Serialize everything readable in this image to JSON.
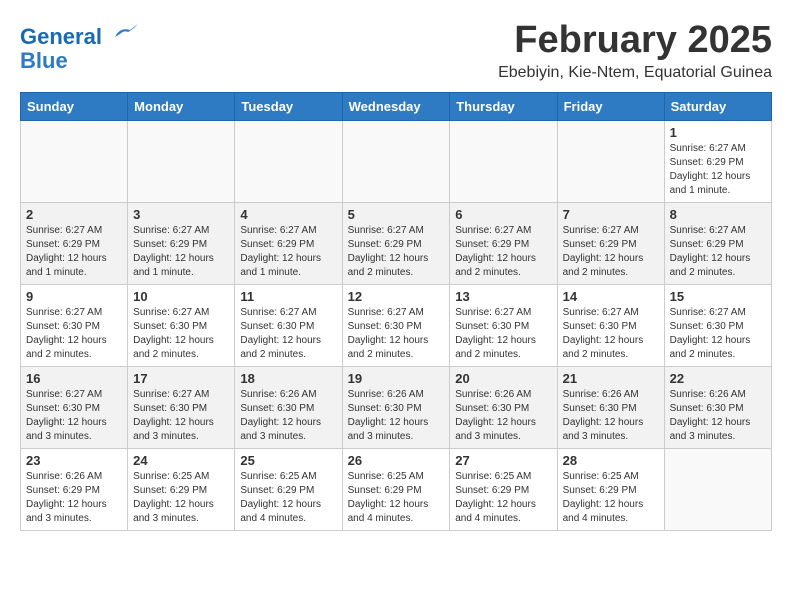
{
  "header": {
    "logo_line1": "General",
    "logo_line2": "Blue",
    "month": "February 2025",
    "location": "Ebebiyin, Kie-Ntem, Equatorial Guinea"
  },
  "days_of_week": [
    "Sunday",
    "Monday",
    "Tuesday",
    "Wednesday",
    "Thursday",
    "Friday",
    "Saturday"
  ],
  "weeks": [
    {
      "days": [
        {
          "number": "",
          "info": ""
        },
        {
          "number": "",
          "info": ""
        },
        {
          "number": "",
          "info": ""
        },
        {
          "number": "",
          "info": ""
        },
        {
          "number": "",
          "info": ""
        },
        {
          "number": "",
          "info": ""
        },
        {
          "number": "1",
          "info": "Sunrise: 6:27 AM\nSunset: 6:29 PM\nDaylight: 12 hours and 1 minute."
        }
      ]
    },
    {
      "days": [
        {
          "number": "2",
          "info": "Sunrise: 6:27 AM\nSunset: 6:29 PM\nDaylight: 12 hours and 1 minute."
        },
        {
          "number": "3",
          "info": "Sunrise: 6:27 AM\nSunset: 6:29 PM\nDaylight: 12 hours and 1 minute."
        },
        {
          "number": "4",
          "info": "Sunrise: 6:27 AM\nSunset: 6:29 PM\nDaylight: 12 hours and 1 minute."
        },
        {
          "number": "5",
          "info": "Sunrise: 6:27 AM\nSunset: 6:29 PM\nDaylight: 12 hours and 2 minutes."
        },
        {
          "number": "6",
          "info": "Sunrise: 6:27 AM\nSunset: 6:29 PM\nDaylight: 12 hours and 2 minutes."
        },
        {
          "number": "7",
          "info": "Sunrise: 6:27 AM\nSunset: 6:29 PM\nDaylight: 12 hours and 2 minutes."
        },
        {
          "number": "8",
          "info": "Sunrise: 6:27 AM\nSunset: 6:29 PM\nDaylight: 12 hours and 2 minutes."
        }
      ]
    },
    {
      "days": [
        {
          "number": "9",
          "info": "Sunrise: 6:27 AM\nSunset: 6:30 PM\nDaylight: 12 hours and 2 minutes."
        },
        {
          "number": "10",
          "info": "Sunrise: 6:27 AM\nSunset: 6:30 PM\nDaylight: 12 hours and 2 minutes."
        },
        {
          "number": "11",
          "info": "Sunrise: 6:27 AM\nSunset: 6:30 PM\nDaylight: 12 hours and 2 minutes."
        },
        {
          "number": "12",
          "info": "Sunrise: 6:27 AM\nSunset: 6:30 PM\nDaylight: 12 hours and 2 minutes."
        },
        {
          "number": "13",
          "info": "Sunrise: 6:27 AM\nSunset: 6:30 PM\nDaylight: 12 hours and 2 minutes."
        },
        {
          "number": "14",
          "info": "Sunrise: 6:27 AM\nSunset: 6:30 PM\nDaylight: 12 hours and 2 minutes."
        },
        {
          "number": "15",
          "info": "Sunrise: 6:27 AM\nSunset: 6:30 PM\nDaylight: 12 hours and 2 minutes."
        }
      ]
    },
    {
      "days": [
        {
          "number": "16",
          "info": "Sunrise: 6:27 AM\nSunset: 6:30 PM\nDaylight: 12 hours and 3 minutes."
        },
        {
          "number": "17",
          "info": "Sunrise: 6:27 AM\nSunset: 6:30 PM\nDaylight: 12 hours and 3 minutes."
        },
        {
          "number": "18",
          "info": "Sunrise: 6:26 AM\nSunset: 6:30 PM\nDaylight: 12 hours and 3 minutes."
        },
        {
          "number": "19",
          "info": "Sunrise: 6:26 AM\nSunset: 6:30 PM\nDaylight: 12 hours and 3 minutes."
        },
        {
          "number": "20",
          "info": "Sunrise: 6:26 AM\nSunset: 6:30 PM\nDaylight: 12 hours and 3 minutes."
        },
        {
          "number": "21",
          "info": "Sunrise: 6:26 AM\nSunset: 6:30 PM\nDaylight: 12 hours and 3 minutes."
        },
        {
          "number": "22",
          "info": "Sunrise: 6:26 AM\nSunset: 6:30 PM\nDaylight: 12 hours and 3 minutes."
        }
      ]
    },
    {
      "days": [
        {
          "number": "23",
          "info": "Sunrise: 6:26 AM\nSunset: 6:29 PM\nDaylight: 12 hours and 3 minutes."
        },
        {
          "number": "24",
          "info": "Sunrise: 6:25 AM\nSunset: 6:29 PM\nDaylight: 12 hours and 3 minutes."
        },
        {
          "number": "25",
          "info": "Sunrise: 6:25 AM\nSunset: 6:29 PM\nDaylight: 12 hours and 4 minutes."
        },
        {
          "number": "26",
          "info": "Sunrise: 6:25 AM\nSunset: 6:29 PM\nDaylight: 12 hours and 4 minutes."
        },
        {
          "number": "27",
          "info": "Sunrise: 6:25 AM\nSunset: 6:29 PM\nDaylight: 12 hours and 4 minutes."
        },
        {
          "number": "28",
          "info": "Sunrise: 6:25 AM\nSunset: 6:29 PM\nDaylight: 12 hours and 4 minutes."
        },
        {
          "number": "",
          "info": ""
        }
      ]
    }
  ]
}
